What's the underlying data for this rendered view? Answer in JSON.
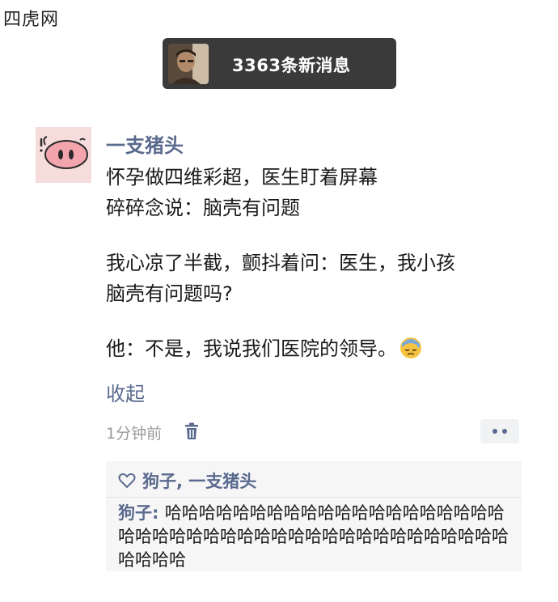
{
  "watermark": "四虎网",
  "banner": {
    "text": "3363条新消息"
  },
  "post": {
    "username": "一支猪头",
    "lines": [
      "怀孕做四维彩超，医生盯着屏幕",
      "碎碎念说：脑壳有问题",
      "我心凉了半截，颤抖着问：医生，我小孩",
      "脑壳有问题吗?",
      "他：不是，我说我们医院的领导。"
    ],
    "emoji": "sweat-face-emoji",
    "collapse_label": "收起",
    "time": "1分钟前"
  },
  "comments": {
    "likes": "狗子, 一支猪头",
    "items": [
      {
        "author": "狗子: ",
        "text": "哈哈哈哈哈哈哈哈哈哈哈哈哈哈哈哈哈哈哈哈哈哈哈哈哈哈哈哈哈哈哈哈哈哈哈哈哈哈哈哈哈哈哈哈哈哈哈"
      }
    ]
  },
  "colors": {
    "link": "#5a6a8e",
    "banner_bg": "#3a3a3a",
    "comment_bg": "#f6f6f6"
  }
}
